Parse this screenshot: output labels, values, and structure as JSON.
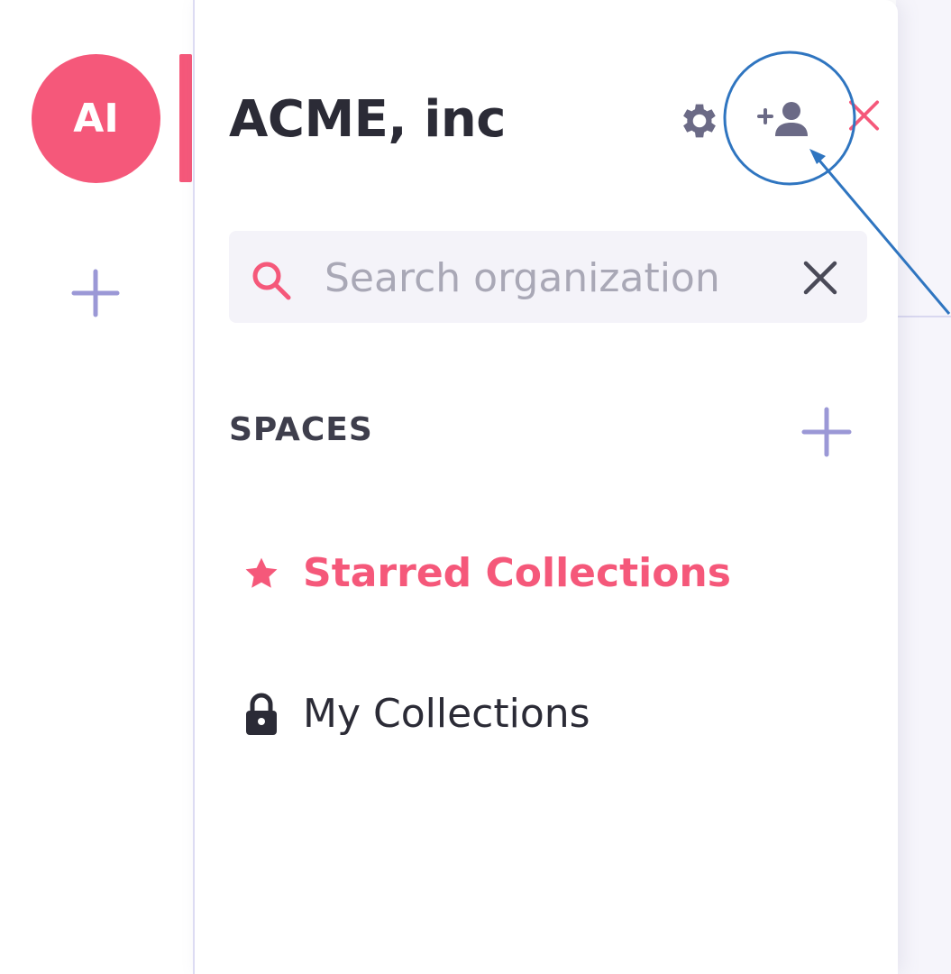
{
  "rail": {
    "avatar_initials": "AI",
    "add_icon": "plus-icon"
  },
  "panel": {
    "org_name": "ACME, inc",
    "actions": {
      "settings_icon": "gear-icon",
      "invite_icon": "add-user-icon",
      "close_icon": "close-icon"
    },
    "search": {
      "placeholder": "Search organization",
      "value": "",
      "icon": "search-icon",
      "clear_icon": "x-icon"
    },
    "spaces": {
      "header": "SPACES",
      "add_icon": "plus-icon",
      "items": [
        {
          "label": "Starred Collections",
          "icon": "star-icon",
          "active": true
        },
        {
          "label": "My Collections",
          "icon": "lock-icon",
          "active": false
        }
      ]
    }
  },
  "colors": {
    "accent": "#f5587a",
    "muted_icon": "#6b6a86",
    "plus": "#9b98d6",
    "annotation": "#2f75c0"
  }
}
